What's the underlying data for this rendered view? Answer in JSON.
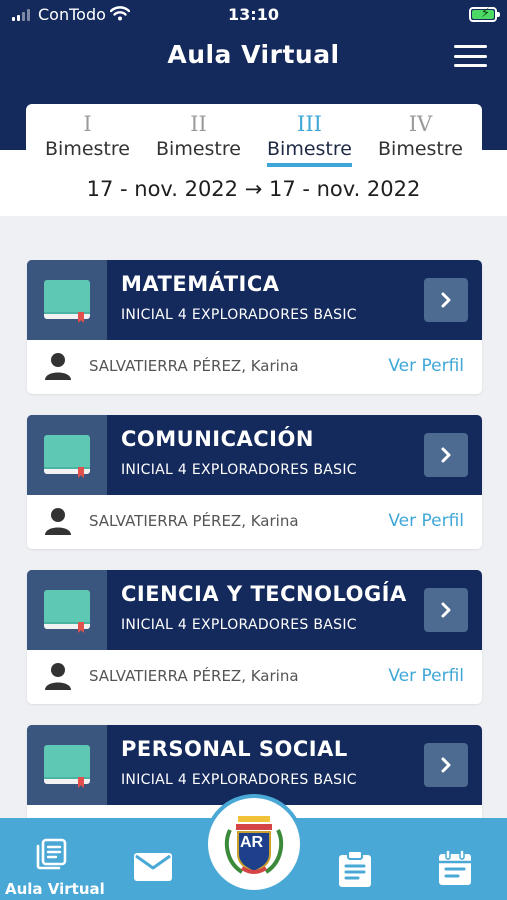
{
  "status_bar": {
    "carrier": "ConTodo",
    "time": "13:10"
  },
  "header": {
    "title": "Aula Virtual"
  },
  "periods": [
    {
      "roman": "I",
      "label": "Bimestre"
    },
    {
      "roman": "II",
      "label": "Bimestre"
    },
    {
      "roman": "III",
      "label": "Bimestre"
    },
    {
      "roman": "IV",
      "label": "Bimestre"
    }
  ],
  "active_period": "III",
  "date_range": "17 - nov. 2022 → 17 - nov. 2022",
  "courses": [
    {
      "name": "MATEMÁTICA",
      "level": "INICIAL 4 EXPLORADORES BASIC",
      "teacher": "SALVATIERRA PÉREZ, Karina",
      "profile_link": "Ver Perfil"
    },
    {
      "name": "COMUNICACIÓN",
      "level": "INICIAL 4 EXPLORADORES BASIC",
      "teacher": "SALVATIERRA PÉREZ, Karina",
      "profile_link": "Ver Perfil"
    },
    {
      "name": "CIENCIA Y TECNOLOGÍA",
      "level": "INICIAL 4 EXPLORADORES BASIC",
      "teacher": "SALVATIERRA PÉREZ, Karina",
      "profile_link": "Ver Perfil"
    },
    {
      "name": "PERSONAL SOCIAL",
      "level": "INICIAL 4 EXPLORADORES BASIC",
      "teacher": "",
      "profile_link": ""
    }
  ],
  "bottom_nav": {
    "active_label": "Aula Virtual",
    "icons": [
      "book-list-icon",
      "mail-icon",
      "school-logo",
      "clipboard-icon",
      "calendar-icon"
    ],
    "logo_text": "AR"
  },
  "colors": {
    "header": "#142a5c",
    "accent": "#3fa7d8",
    "nav": "#4aa8d6",
    "book": "#5fc8b5"
  }
}
